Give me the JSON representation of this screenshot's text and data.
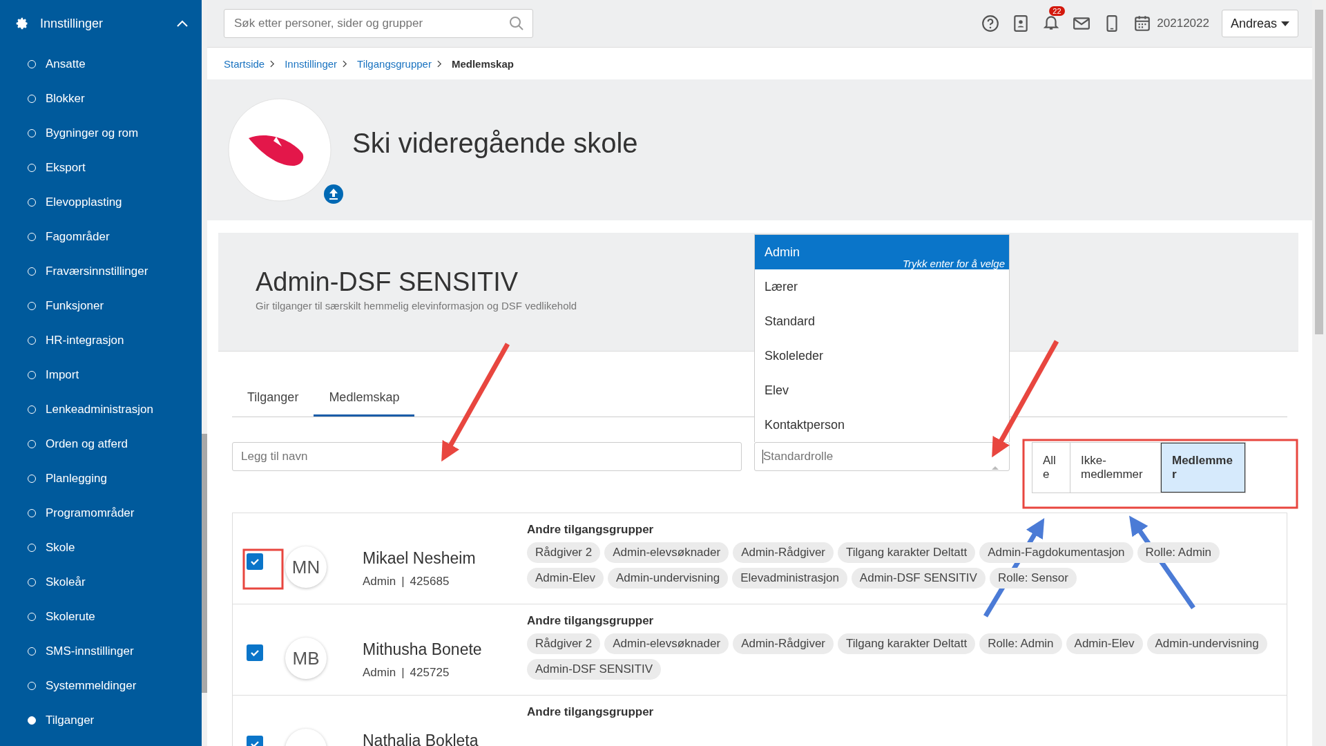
{
  "sidebar": {
    "title": "Innstillinger",
    "expanded": true,
    "items": [
      {
        "label": "Ansatte",
        "selected": false
      },
      {
        "label": "Blokker",
        "selected": false
      },
      {
        "label": "Bygninger og rom",
        "selected": false
      },
      {
        "label": "Eksport",
        "selected": false
      },
      {
        "label": "Elevopplasting",
        "selected": false
      },
      {
        "label": "Fagområder",
        "selected": false
      },
      {
        "label": "Fraværsinnstillinger",
        "selected": false
      },
      {
        "label": "Funksjoner",
        "selected": false
      },
      {
        "label": "HR-integrasjon",
        "selected": false
      },
      {
        "label": "Import",
        "selected": false
      },
      {
        "label": "Lenkeadministrasjon",
        "selected": false
      },
      {
        "label": "Orden og atferd",
        "selected": false
      },
      {
        "label": "Planlegging",
        "selected": false
      },
      {
        "label": "Programområder",
        "selected": false
      },
      {
        "label": "Skole",
        "selected": false
      },
      {
        "label": "Skoleår",
        "selected": false
      },
      {
        "label": "Skolerute",
        "selected": false
      },
      {
        "label": "SMS-innstillinger",
        "selected": false
      },
      {
        "label": "Systemmeldinger",
        "selected": false
      },
      {
        "label": "Tilganger",
        "selected": true
      }
    ]
  },
  "topbar": {
    "search": {
      "placeholder": "Søk etter personer, sider og grupper"
    },
    "notifications": "22",
    "year": "20212022",
    "user": "Andreas"
  },
  "breadcrumb": [
    {
      "label": "Startside",
      "current": false
    },
    {
      "label": "Innstillinger",
      "current": false
    },
    {
      "label": "Tilgangsgrupper",
      "current": false
    },
    {
      "label": "Medlemskap",
      "current": true
    }
  ],
  "school": {
    "name": "Ski videregående skole"
  },
  "group": {
    "title": "Admin-DSF SENSITIV",
    "description": "Gir tilganger til særskilt hemmelig elevinformasjon og DSF vedlikehold"
  },
  "tabs": [
    {
      "label": "Tilganger",
      "selected": false
    },
    {
      "label": "Medlemskap",
      "selected": true
    }
  ],
  "name_field": {
    "placeholder": "Legg til navn"
  },
  "role_field": {
    "placeholder": "Standardrolle",
    "hint": "Trykk enter for å velge",
    "options": [
      {
        "label": "Admin",
        "selected": true
      },
      {
        "label": "Lærer",
        "selected": false
      },
      {
        "label": "Standard",
        "selected": false
      },
      {
        "label": "Skoleleder",
        "selected": false
      },
      {
        "label": "Elev",
        "selected": false
      },
      {
        "label": "Kontaktperson",
        "selected": false
      }
    ]
  },
  "filter": [
    {
      "label": "Alle",
      "selected": false
    },
    {
      "label": "Ikke-medlemmer",
      "selected": false
    },
    {
      "label": "Medlemmer",
      "selected": true
    }
  ],
  "members": [
    {
      "initials": "MN",
      "name": "Mikael Nesheim",
      "role": "Admin",
      "separator": "|",
      "id": "425685",
      "checked": true,
      "groups_heading": "Andre tilgangsgrupper",
      "groups": [
        "Rådgiver 2",
        "Admin-elevsøknader",
        "Admin-Rådgiver",
        "Tilgang karakter Deltatt",
        "Admin-Fagdokumentasjon",
        "Rolle: Admin",
        "Admin-Elev",
        "Admin-undervisning",
        "Elevadministrasjon",
        "Admin-DSF SENSITIV",
        "Rolle: Sensor"
      ]
    },
    {
      "initials": "MB",
      "name": "Mithusha Bonete",
      "role": "Admin",
      "separator": "|",
      "id": "425725",
      "checked": true,
      "groups_heading": "Andre tilgangsgrupper",
      "groups": [
        "Rådgiver 2",
        "Admin-elevsøknader",
        "Admin-Rådgiver",
        "Tilgang karakter Deltatt",
        "Rolle: Admin",
        "Admin-Elev",
        "Admin-undervisning",
        "Admin-DSF SENSITIV"
      ]
    },
    {
      "name": "Nathalia Bokleta",
      "checked": true,
      "groups_heading": "Andre tilgangsgrupper"
    }
  ]
}
